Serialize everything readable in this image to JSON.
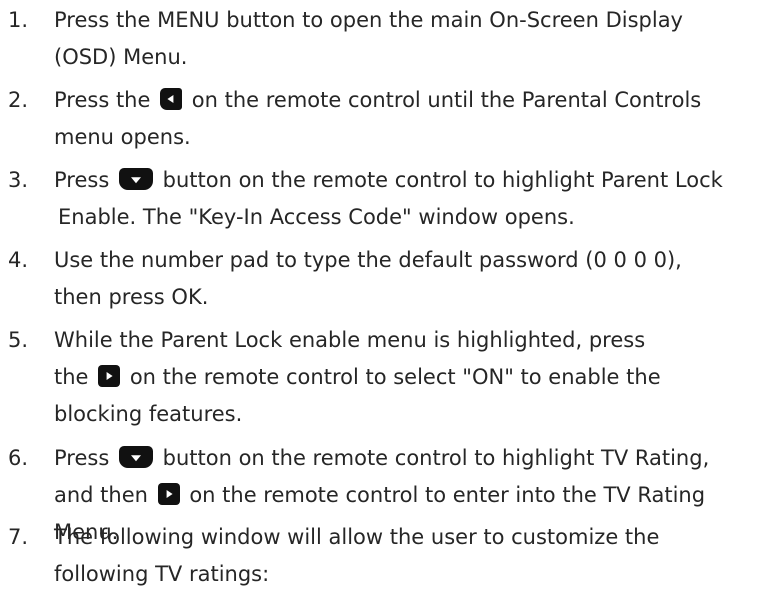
{
  "steps": [
    {
      "number": "1.",
      "lines": [
        {
          "text": "Press the MENU button to open the main On-Screen Display"
        },
        {
          "text": "(OSD) Menu."
        }
      ]
    },
    {
      "number": "2.",
      "lines": [
        {
          "before": "Press the ",
          "icon": "left-arrow-button-icon",
          "after": " on the remote control until the Parental Controls"
        },
        {
          "text": "menu opens."
        }
      ]
    },
    {
      "number": "3.",
      "lines": [
        {
          "before": "Press ",
          "icon": "down-arrow-button-icon",
          "after": " button on the remote control to highlight Parent Lock"
        },
        {
          "text": "Enable. The \"Key-In Access Code\" window opens."
        }
      ]
    },
    {
      "number": "4.",
      "lines": [
        {
          "text": "Use the number pad to type the default password (0 0 0 0),"
        },
        {
          "text": "then press OK."
        }
      ]
    },
    {
      "number": "5.",
      "lines": [
        {
          "text": "While the Parent Lock enable menu is highlighted, press"
        },
        {
          "before": "the ",
          "icon": "right-arrow-button-icon",
          "after": " on the remote control to select \"ON\" to enable the"
        },
        {
          "text": "blocking features."
        }
      ]
    },
    {
      "number": "6.",
      "lines": [
        {
          "before": "Press ",
          "icon": "down-arrow-button-icon",
          "after": " button on the remote control to highlight TV Rating,"
        },
        {
          "before": "and then ",
          "icon": "right-arrow-button-icon",
          "after": " on the remote control to enter into the TV Rating"
        },
        {
          "text": "Menu."
        }
      ]
    },
    {
      "number": "7.",
      "lines": [
        {
          "text": "The following window will allow the user to customize the"
        },
        {
          "text": "following TV ratings:"
        }
      ]
    }
  ]
}
